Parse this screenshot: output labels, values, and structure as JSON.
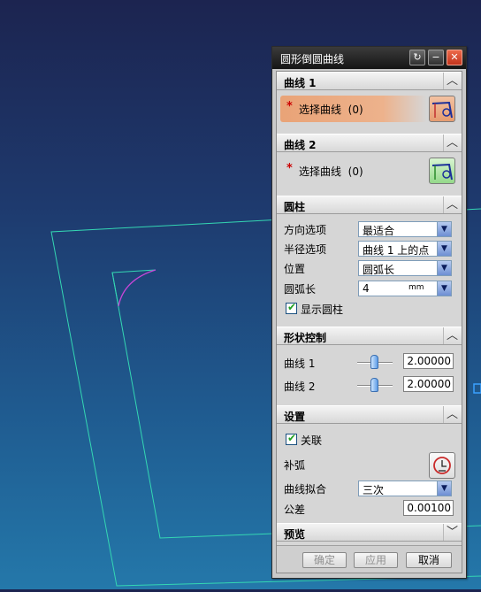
{
  "dialog": {
    "title": "圆形倒圆曲线",
    "title_buttons": {
      "reset_glyph": "↻",
      "minimize_glyph": "−",
      "close_glyph": "✕"
    }
  },
  "curve1": {
    "header": "曲线 1",
    "select_label": "选择曲线",
    "select_count": "(0)",
    "required_mark": "*"
  },
  "curve2": {
    "header": "曲线 2",
    "select_label": "选择曲线",
    "select_count": "(0)",
    "required_mark": "*"
  },
  "cylinder": {
    "header": "圆柱",
    "direction_label": "方向选项",
    "direction_value": "最适合",
    "radius_label": "半径选项",
    "radius_value": "曲线 1 上的点",
    "position_label": "位置",
    "position_value": "圆弧长",
    "arc_length_label": "圆弧长",
    "arc_length_value": "4",
    "arc_length_unit": "mm",
    "show_cylinder_label": "显示圆柱",
    "show_cylinder_checked": true
  },
  "shape_control": {
    "header": "形状控制",
    "curve1_label": "曲线 1",
    "curve1_value": "2.00000",
    "curve2_label": "曲线 2",
    "curve2_value": "2.00000"
  },
  "settings": {
    "header": "设置",
    "associative_label": "关联",
    "associative_checked": true,
    "complement_arc_label": "补弧",
    "curve_fit_label": "曲线拟合",
    "curve_fit_value": "三次",
    "tolerance_label": "公差",
    "tolerance_value": "0.00100"
  },
  "preview": {
    "header": "预览"
  },
  "footer": {
    "ok_label": "确定",
    "apply_label": "应用",
    "cancel_label": "取消"
  },
  "icons": {
    "collapse": "up-chevron-icon",
    "expand": "down-chevron-icon",
    "combo_arrow": "down-arrow-icon",
    "spinner": "down-arrow-icon"
  },
  "colors": {
    "viewport_top": "#1c2450",
    "viewport_bottom": "#2478aa",
    "wireframe": "#34d7b3",
    "arc": "#c846d8",
    "active_selection": "#e9a377",
    "close_button": "#d8452a"
  }
}
